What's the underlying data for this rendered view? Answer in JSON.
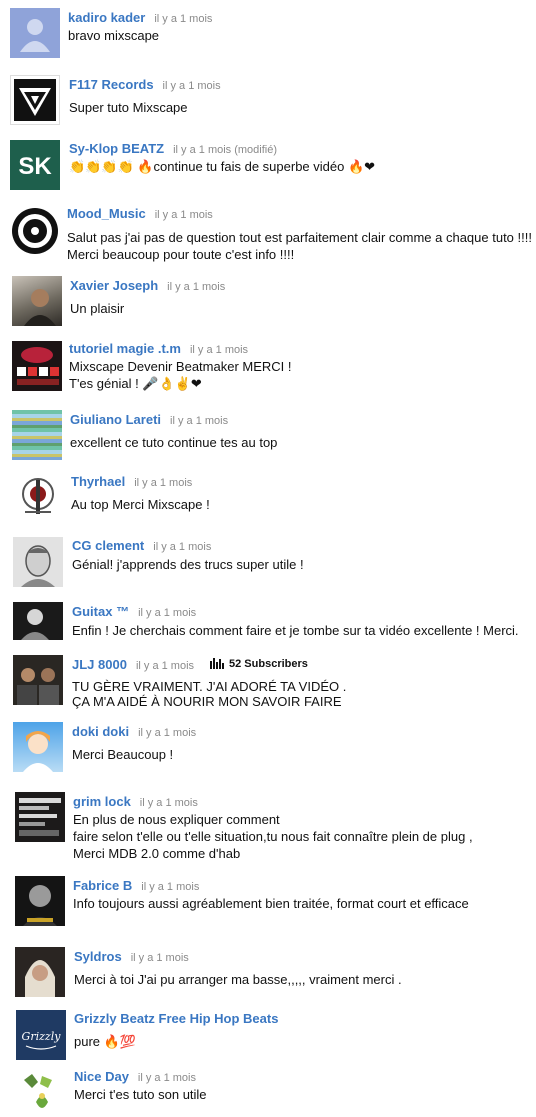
{
  "comments": [
    {
      "author": "kadiro kader",
      "time": "il y a 1 mois",
      "lines": [
        "bravo mixscape"
      ],
      "avatar_icon": "default-user-icon"
    },
    {
      "author": "F117 Records",
      "time": "il y a 1 mois",
      "lines": [
        "Super tuto Mixscape"
      ],
      "avatar_icon": "f117-logo-icon"
    },
    {
      "author": "Sy-Klop BEATZ",
      "time": "il y a 1 mois (modifié)",
      "lines": [
        "👏👏👏👏 🔥continue  tu fais de superbe  vidéo 🔥❤"
      ],
      "avatar_icon": "sk-logo-icon"
    },
    {
      "author": "Mood_Music",
      "time": "il y a 1 mois",
      "lines": [
        "Salut pas j'ai pas de question tout est parfaitement clair comme a chaque tuto !!!!",
        "Merci beaucoup pour toute c'est info !!!!"
      ],
      "avatar_icon": "vinyl-logo-icon"
    },
    {
      "author": "Xavier Joseph",
      "time": "il y a 1 mois",
      "lines": [
        "Un plaisir"
      ],
      "avatar_icon": "photo-avatar-icon"
    },
    {
      "author": "tutoriel magie .t.m",
      "time": "il y a 1 mois",
      "lines": [
        "Mixscape Devenir Beatmaker MERCI !",
        "T'es génial ! 🎤👌✌❤"
      ],
      "avatar_icon": "magic-cards-icon"
    },
    {
      "author": "Giuliano Lareti",
      "time": "il y a 1 mois",
      "lines": [
        "excellent ce tuto continue tes au top"
      ],
      "avatar_icon": "glitch-avatar-icon"
    },
    {
      "author": "Thyrhael",
      "time": "il y a 1 mois",
      "lines": [
        "Au top Merci Mixscape !"
      ],
      "avatar_icon": "skull-logo-icon"
    },
    {
      "author": "CG clement",
      "time": "il y a 1 mois",
      "lines": [
        "Génial!  j'apprends des trucs super utile !"
      ],
      "avatar_icon": "sketch-portrait-icon"
    },
    {
      "author": "Guitax ™",
      "time": "il y a 1 mois",
      "lines": [
        "Enfin ! Je cherchais comment faire et je tombe sur ta vidéo excellente ! Merci."
      ],
      "avatar_icon": "bw-portrait-icon"
    },
    {
      "author": "JLJ 8000",
      "time": "il y a 1 mois",
      "subscribers": "52 Subscribers",
      "lines": [
        "TU GÈRE VRAIMENT. J'AI ADORÉ TA VIDÉO .",
        "ÇA M'A AIDÉ À NOURIR MON SAVOIR FAIRE"
      ],
      "avatar_icon": "duo-photo-icon"
    },
    {
      "author": "doki doki",
      "time": "il y a 1 mois",
      "lines": [
        "Merci Beaucoup !"
      ],
      "avatar_icon": "anime-avatar-icon"
    },
    {
      "author": "grim lock",
      "time": "il y a 1 mois",
      "lines": [
        "En plus de nous expliquer comment",
        "faire selon t'elle ou t'elle situation,tu nous fait connaître plein de plug ,",
        "Merci MDB 2.0  comme d'hab"
      ],
      "avatar_icon": "poster-avatar-icon"
    },
    {
      "author": "Fabrice B",
      "time": "il y a 1 mois",
      "lines": [
        "Info toujours aussi agréablement bien traitée, format court et efficace"
      ],
      "avatar_icon": "dark-portrait-icon"
    },
    {
      "author": "Syldros",
      "time": "il y a 1 mois",
      "lines": [
        "Merci à toi  J'ai pu arranger ma basse,,,,, vraiment merci ."
      ],
      "avatar_icon": "blonde-portrait-icon"
    },
    {
      "author": "Grizzly Beatz Free Hip Hop Beats",
      "time": "",
      "lines": [
        "pure 🔥💯"
      ],
      "avatar_icon": "grizzly-logo-icon"
    },
    {
      "author": "Nice Day",
      "time": "il y a 1 mois",
      "lines": [
        "Merci t'es tuto son utile"
      ],
      "avatar_icon": "cartoon-avatar-icon"
    }
  ]
}
